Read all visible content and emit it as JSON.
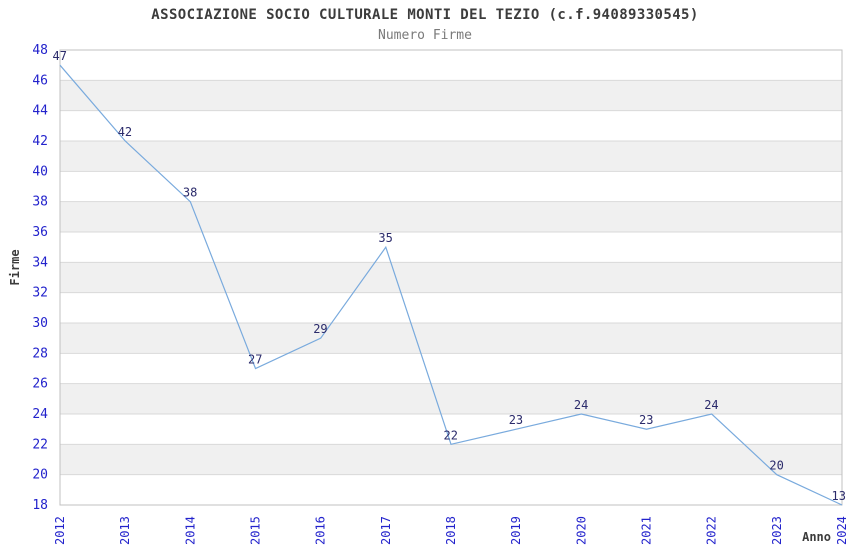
{
  "chart_data": {
    "type": "line",
    "title": "ASSOCIAZIONE SOCIO CULTURALE MONTI DEL TEZIO (c.f.94089330545)",
    "subtitle": "Numero Firme",
    "xlabel": "Anno",
    "ylabel": "Firme",
    "categories": [
      "2012",
      "2013",
      "2014",
      "2015",
      "2016",
      "2017",
      "2018",
      "2019",
      "2020",
      "2021",
      "2022",
      "2023",
      "2024"
    ],
    "series": [
      {
        "name": "Numero Firme",
        "values": [
          47,
          42,
          38,
          27,
          29,
          35,
          22,
          23,
          24,
          23,
          24,
          20,
          13
        ]
      }
    ],
    "ylim": [
      18,
      48
    ],
    "ytick_step": 2,
    "yticks": [
      18,
      20,
      22,
      24,
      26,
      28,
      30,
      32,
      34,
      36,
      38,
      40,
      42,
      44,
      46,
      48
    ],
    "grid": true,
    "legend_position": "none",
    "value_labels_shown": true,
    "x_labels_rotated_degrees": 90,
    "min_clamped_to_axis": true,
    "colors": {
      "line": "#79aadd",
      "tick_label": "#2323cc",
      "value_label": "#2b2b6b",
      "title": "#3c3c3c",
      "subtitle": "#7a7a7a",
      "axis_label": "#3c3c3c",
      "band": "#f0f0f0",
      "grid": "#d9d9d9",
      "border": "#c0c0c0",
      "background": "#ffffff"
    }
  }
}
